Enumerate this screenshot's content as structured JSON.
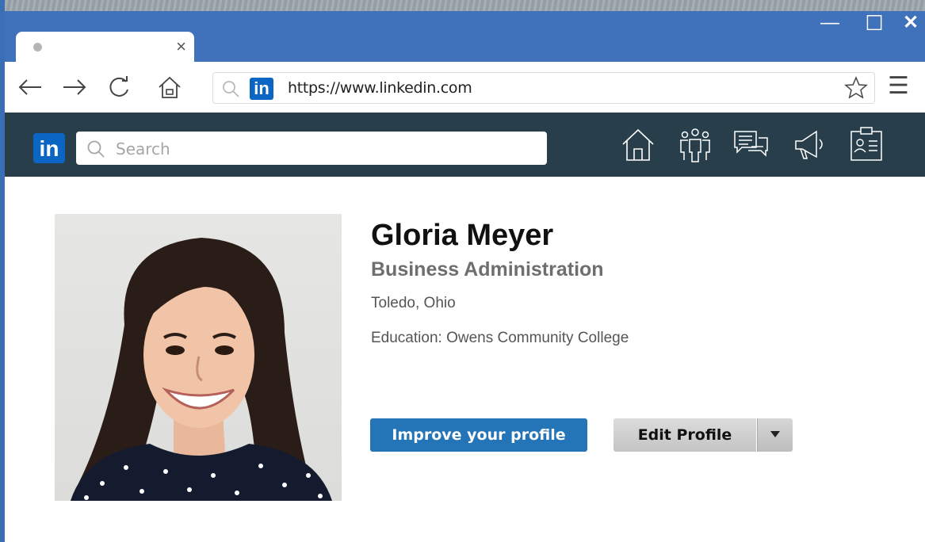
{
  "browser": {
    "tab_close": "×",
    "window_controls": {
      "minimize": "—",
      "maximize": "☐",
      "close": "✕"
    },
    "url": "https://www.linkedin.com",
    "site_badge": "in",
    "menu_glyph": "☰"
  },
  "linkedin": {
    "logo": "in",
    "search_placeholder": "Search",
    "nav_icons": [
      "home-icon",
      "network-icon",
      "messaging-icon",
      "megaphone-icon",
      "profile-card-icon"
    ]
  },
  "profile": {
    "name": "Gloria Meyer",
    "headline": "Business Administration",
    "location": "Toledo, Ohio",
    "education": "Education: Owens Community College",
    "improve_button": "Improve your profile",
    "edit_button": "Edit Profile"
  },
  "colors": {
    "titlebar": "#3f72ba",
    "linkedin_header": "#283e4a",
    "linkedin_blue": "#0a66c2",
    "primary_button": "#2474b8"
  }
}
